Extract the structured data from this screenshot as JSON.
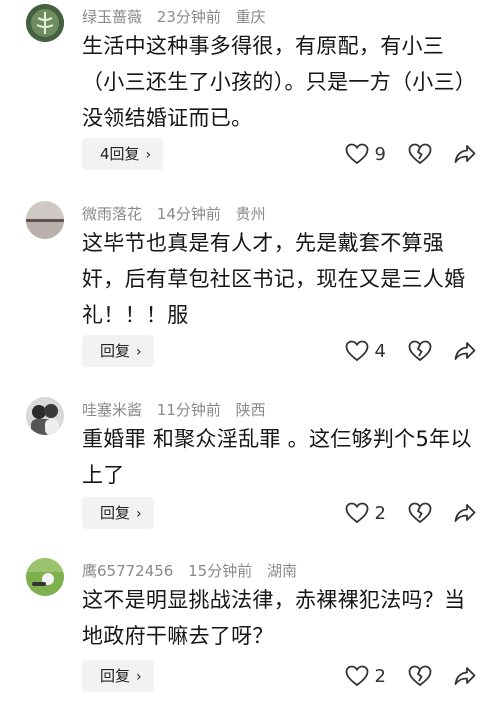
{
  "comments": [
    {
      "username": "绿玉蔷薇",
      "time": "23分钟前",
      "location": "重庆",
      "text": "生活中这种事多得很，有原配，有小三（小三还生了小孩的）。只是一方（小三）没领结婚证而已。",
      "reply_label": "4回复",
      "likes": "9",
      "avatar_icon": "plant-avatar"
    },
    {
      "username": "微雨落花",
      "time": "14分钟前",
      "location": "贵州",
      "text": "这毕节也真是有人才，先是戴套不算强奸，后有草包社区书记，现在又是三人婚礼！！！服",
      "reply_label": "回复",
      "likes": "4",
      "avatar_icon": "seascape-avatar"
    },
    {
      "username": "哇塞米酱",
      "time": "11分钟前",
      "location": "陕西",
      "text": "重婚罪 和聚众淫乱罪 。这仨够判个5年以上了",
      "reply_label": "回复",
      "likes": "2",
      "avatar_icon": "people-avatar"
    },
    {
      "username": "鹰65772456",
      "time": "15分钟前",
      "location": "湖南",
      "text": "这不是明显挑战法律，赤裸裸犯法吗？当地政府干嘛去了呀？",
      "reply_label": "回复",
      "likes": "2",
      "avatar_icon": "golf-avatar"
    }
  ],
  "icons": {
    "like": "heart-outline-icon",
    "dislike": "broken-heart-icon",
    "share": "share-arrow-icon",
    "chevron": "chevron-right-icon"
  },
  "chevron_glyph": "›"
}
